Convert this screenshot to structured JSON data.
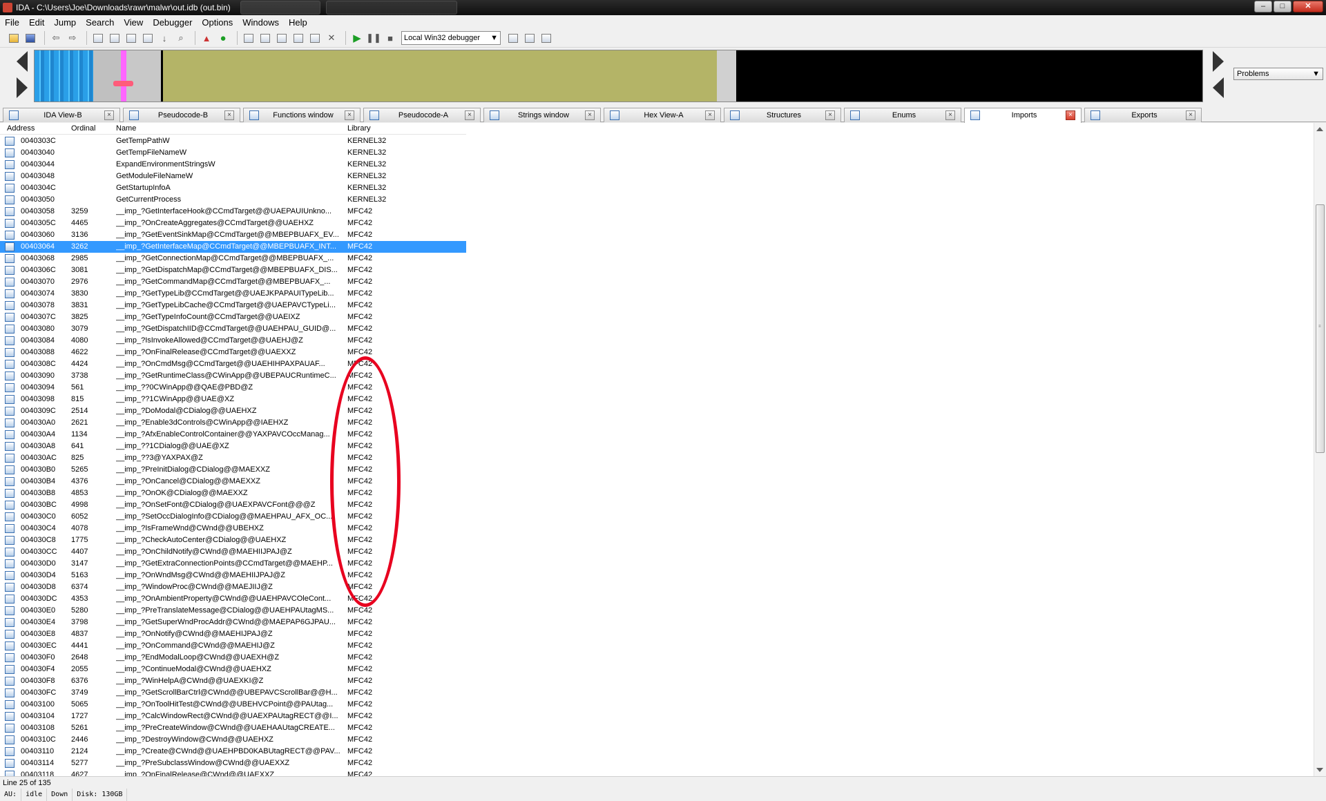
{
  "window": {
    "title": "IDA - C:\\Users\\Joe\\Downloads\\rawr\\malwr\\out.idb (out.bin)",
    "controls": [
      "minimize",
      "maximize",
      "close"
    ]
  },
  "menu": [
    "File",
    "Edit",
    "Jump",
    "Search",
    "View",
    "Debugger",
    "Options",
    "Windows",
    "Help"
  ],
  "toolbar": {
    "debugger_select": "Local Win32 debugger"
  },
  "navband": {
    "segment_colors": [
      "#2a9fe8",
      "#c0c0c0",
      "#ff66ff",
      "#b4b467",
      "#000000"
    ],
    "problems_select": "Problems"
  },
  "tabs": [
    {
      "label": "IDA View-B",
      "icon": "ida-view-icon"
    },
    {
      "label": "Pseudocode-B",
      "icon": "pseudocode-icon"
    },
    {
      "label": "Functions window",
      "icon": "function-icon"
    },
    {
      "label": "Pseudocode-A",
      "icon": "pseudocode-icon"
    },
    {
      "label": "Strings window",
      "icon": "strings-icon"
    },
    {
      "label": "Hex View-A",
      "icon": "hex-icon"
    },
    {
      "label": "Structures",
      "icon": "structures-icon"
    },
    {
      "label": "Enums",
      "icon": "enums-icon"
    },
    {
      "label": "Imports",
      "icon": "imports-icon",
      "active": true
    },
    {
      "label": "Exports",
      "icon": "exports-icon"
    }
  ],
  "columns": [
    "Address",
    "Ordinal",
    "Name",
    "Library"
  ],
  "rows": [
    [
      "0040303C",
      "",
      "GetTempPathW",
      "KERNEL32"
    ],
    [
      "00403040",
      "",
      "GetTempFileNameW",
      "KERNEL32"
    ],
    [
      "00403044",
      "",
      "ExpandEnvironmentStringsW",
      "KERNEL32"
    ],
    [
      "00403048",
      "",
      "GetModuleFileNameW",
      "KERNEL32"
    ],
    [
      "0040304C",
      "",
      "GetStartupInfoA",
      "KERNEL32"
    ],
    [
      "00403050",
      "",
      "GetCurrentProcess",
      "KERNEL32"
    ],
    [
      "00403058",
      "3259",
      "__imp_?GetInterfaceHook@CCmdTarget@@UAEPAUIUnkno...",
      "MFC42"
    ],
    [
      "0040305C",
      "4465",
      "__imp_?OnCreateAggregates@CCmdTarget@@UAEHXZ",
      "MFC42"
    ],
    [
      "00403060",
      "3136",
      "__imp_?GetEventSinkMap@CCmdTarget@@MBEPBUAFX_EV...",
      "MFC42"
    ],
    [
      "00403064",
      "3262",
      "__imp_?GetInterfaceMap@CCmdTarget@@MBEPBUAFX_INT...",
      "MFC42"
    ],
    [
      "00403068",
      "2985",
      "__imp_?GetConnectionMap@CCmdTarget@@MBEPBUAFX_...",
      "MFC42"
    ],
    [
      "0040306C",
      "3081",
      "__imp_?GetDispatchMap@CCmdTarget@@MBEPBUAFX_DIS...",
      "MFC42"
    ],
    [
      "00403070",
      "2976",
      "__imp_?GetCommandMap@CCmdTarget@@MBEPBUAFX_...",
      "MFC42"
    ],
    [
      "00403074",
      "3830",
      "__imp_?GetTypeLib@CCmdTarget@@UAEJKPAPAUITypeLib...",
      "MFC42"
    ],
    [
      "00403078",
      "3831",
      "__imp_?GetTypeLibCache@CCmdTarget@@UAEPAVCTypeLi...",
      "MFC42"
    ],
    [
      "0040307C",
      "3825",
      "__imp_?GetTypeInfoCount@CCmdTarget@@UAEIXZ",
      "MFC42"
    ],
    [
      "00403080",
      "3079",
      "__imp_?GetDispatchIID@CCmdTarget@@UAEHPAU_GUID@...",
      "MFC42"
    ],
    [
      "00403084",
      "4080",
      "__imp_?IsInvokeAllowed@CCmdTarget@@UAEHJ@Z",
      "MFC42"
    ],
    [
      "00403088",
      "4622",
      "__imp_?OnFinalRelease@CCmdTarget@@UAEXXZ",
      "MFC42"
    ],
    [
      "0040308C",
      "4424",
      "__imp_?OnCmdMsg@CCmdTarget@@UAEHIHPAXPAUAF...",
      "MFC42"
    ],
    [
      "00403090",
      "3738",
      "__imp_?GetRuntimeClass@CWinApp@@UBEPAUCRuntimeC...",
      "MFC42"
    ],
    [
      "00403094",
      "561",
      "__imp_??0CWinApp@@QAE@PBD@Z",
      "MFC42"
    ],
    [
      "00403098",
      "815",
      "__imp_??1CWinApp@@UAE@XZ",
      "MFC42"
    ],
    [
      "0040309C",
      "2514",
      "__imp_?DoModal@CDialog@@UAEHXZ",
      "MFC42"
    ],
    [
      "004030A0",
      "2621",
      "__imp_?Enable3dControls@CWinApp@@IAEHXZ",
      "MFC42"
    ],
    [
      "004030A4",
      "1134",
      "__imp_?AfxEnableControlContainer@@YAXPAVCOccManag...",
      "MFC42"
    ],
    [
      "004030A8",
      "641",
      "__imp_??1CDialog@@UAE@XZ",
      "MFC42"
    ],
    [
      "004030AC",
      "825",
      "__imp_??3@YAXPAX@Z",
      "MFC42"
    ],
    [
      "004030B0",
      "5265",
      "__imp_?PreInitDialog@CDialog@@MAEXXZ",
      "MFC42"
    ],
    [
      "004030B4",
      "4376",
      "__imp_?OnCancel@CDialog@@MAEXXZ",
      "MFC42"
    ],
    [
      "004030B8",
      "4853",
      "__imp_?OnOK@CDialog@@MAEXXZ",
      "MFC42"
    ],
    [
      "004030BC",
      "4998",
      "__imp_?OnSetFont@CDialog@@UAEXPAVCFont@@@Z",
      "MFC42"
    ],
    [
      "004030C0",
      "6052",
      "__imp_?SetOccDialogInfo@CDialog@@MAEHPAU_AFX_OC...",
      "MFC42"
    ],
    [
      "004030C4",
      "4078",
      "__imp_?IsFrameWnd@CWnd@@UBEHXZ",
      "MFC42"
    ],
    [
      "004030C8",
      "1775",
      "__imp_?CheckAutoCenter@CDialog@@UAEHXZ",
      "MFC42"
    ],
    [
      "004030CC",
      "4407",
      "__imp_?OnChildNotify@CWnd@@MAEHIIJPAJ@Z",
      "MFC42"
    ],
    [
      "004030D0",
      "3147",
      "__imp_?GetExtraConnectionPoints@CCmdTarget@@MAEHP...",
      "MFC42"
    ],
    [
      "004030D4",
      "5163",
      "__imp_?OnWndMsg@CWnd@@MAEHIIJPAJ@Z",
      "MFC42"
    ],
    [
      "004030D8",
      "6374",
      "__imp_?WindowProc@CWnd@@MAEJIIJ@Z",
      "MFC42"
    ],
    [
      "004030DC",
      "4353",
      "__imp_?OnAmbientProperty@CWnd@@UAEHPAVCOleCont...",
      "MFC42"
    ],
    [
      "004030E0",
      "5280",
      "__imp_?PreTranslateMessage@CDialog@@UAEHPAUtagMS...",
      "MFC42"
    ],
    [
      "004030E4",
      "3798",
      "__imp_?GetSuperWndProcAddr@CWnd@@MAEPAP6GJPAU...",
      "MFC42"
    ],
    [
      "004030E8",
      "4837",
      "__imp_?OnNotify@CWnd@@MAEHIJPAJ@Z",
      "MFC42"
    ],
    [
      "004030EC",
      "4441",
      "__imp_?OnCommand@CWnd@@MAEHIJ@Z",
      "MFC42"
    ],
    [
      "004030F0",
      "2648",
      "__imp_?EndModalLoop@CWnd@@UAEXH@Z",
      "MFC42"
    ],
    [
      "004030F4",
      "2055",
      "__imp_?ContinueModal@CWnd@@UAEHXZ",
      "MFC42"
    ],
    [
      "004030F8",
      "6376",
      "__imp_?WinHelpA@CWnd@@UAEXKI@Z",
      "MFC42"
    ],
    [
      "004030FC",
      "3749",
      "__imp_?GetScrollBarCtrl@CWnd@@UBEPAVCScrollBar@@H...",
      "MFC42"
    ],
    [
      "00403100",
      "5065",
      "__imp_?OnToolHitTest@CWnd@@UBEHVCPoint@@PAUtag...",
      "MFC42"
    ],
    [
      "00403104",
      "1727",
      "__imp_?CalcWindowRect@CWnd@@UAEXPAUtagRECT@@I...",
      "MFC42"
    ],
    [
      "00403108",
      "5261",
      "__imp_?PreCreateWindow@CWnd@@UAEHAAUtagCREATE...",
      "MFC42"
    ],
    [
      "0040310C",
      "2446",
      "__imp_?DestroyWindow@CWnd@@UAEHXZ",
      "MFC42"
    ],
    [
      "00403110",
      "2124",
      "__imp_?Create@CWnd@@UAEHPBD0KABUtagRECT@@PAV...",
      "MFC42"
    ],
    [
      "00403114",
      "5277",
      "__imp_?PreSubclassWindow@CWnd@@UAEXXZ",
      "MFC42"
    ],
    [
      "00403118",
      "4627",
      "__imp_?OnFinalRelease@CWnd@@UAEXXZ",
      "MFC42"
    ]
  ],
  "selected_row_index": 9,
  "status": {
    "line_info": "Line 25 of 135",
    "au": "AU:",
    "au_state": "idle",
    "direction": "Down",
    "disk": "Disk: 130GB"
  }
}
